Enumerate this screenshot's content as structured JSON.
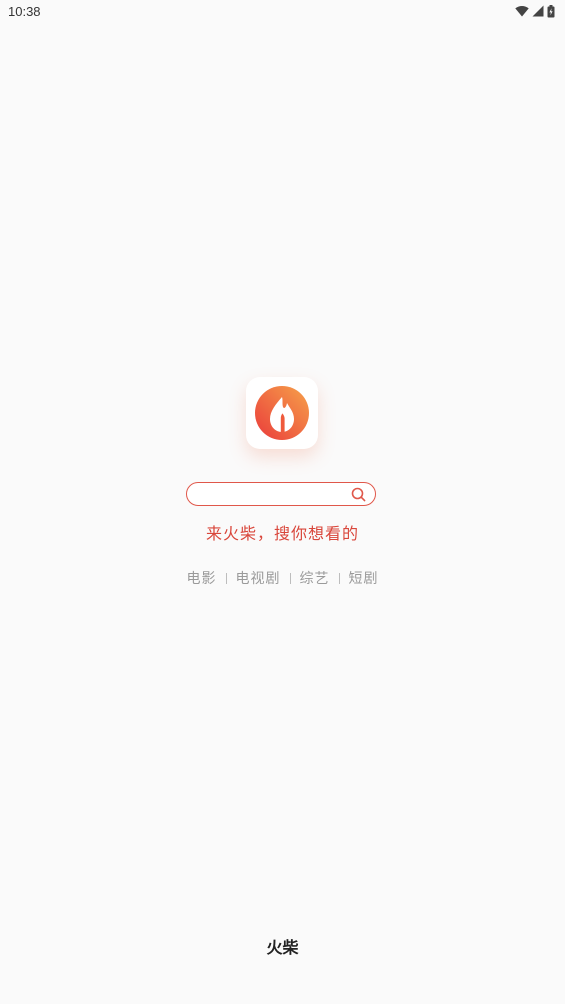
{
  "status_bar": {
    "time": "10:38",
    "icons": [
      "wifi-icon",
      "cellular-signal-icon",
      "battery-charging-icon"
    ]
  },
  "app_icon": {
    "name": "flame-logo-icon",
    "gradient_start": "#f6a24a",
    "gradient_end": "#ea3b3b"
  },
  "search": {
    "value": "",
    "placeholder": "",
    "border_color": "#e0574a"
  },
  "slogan": "来火柴，搜你想看的",
  "categories": [
    "电影",
    "电视剧",
    "综艺",
    "短剧"
  ],
  "footer": {
    "brand": "火柴"
  },
  "colors": {
    "accent": "#d9463b",
    "background": "#fafafa"
  }
}
